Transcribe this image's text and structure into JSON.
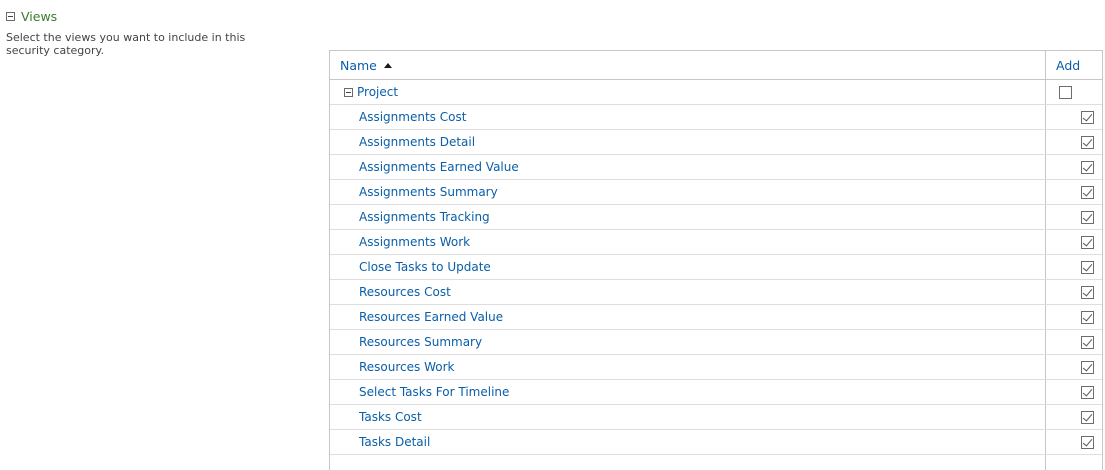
{
  "section": {
    "title": "Views",
    "description": "Select the views you want to include in this security category."
  },
  "grid": {
    "columns": {
      "name": "Name",
      "add": "Add"
    },
    "group": {
      "label": "Project",
      "checked": false
    },
    "items": [
      {
        "label": "Assignments Cost",
        "checked": true
      },
      {
        "label": "Assignments Detail",
        "checked": true
      },
      {
        "label": "Assignments Earned Value",
        "checked": true
      },
      {
        "label": "Assignments Summary",
        "checked": true
      },
      {
        "label": "Assignments Tracking",
        "checked": true
      },
      {
        "label": "Assignments Work",
        "checked": true
      },
      {
        "label": "Close Tasks to Update",
        "checked": true
      },
      {
        "label": "Resources Cost",
        "checked": true
      },
      {
        "label": "Resources Earned Value",
        "checked": true
      },
      {
        "label": "Resources Summary",
        "checked": true
      },
      {
        "label": "Resources Work",
        "checked": true
      },
      {
        "label": "Select Tasks For Timeline",
        "checked": true
      },
      {
        "label": "Tasks Cost",
        "checked": true
      },
      {
        "label": "Tasks Detail",
        "checked": true
      },
      {
        "label": "",
        "checked": false
      }
    ]
  }
}
